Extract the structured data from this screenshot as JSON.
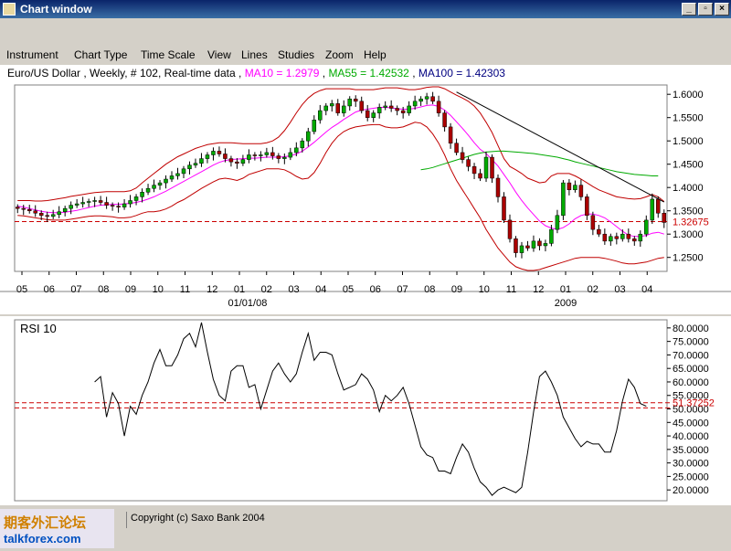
{
  "window": {
    "title": "Chart window",
    "btn_min": "_",
    "btn_max": "▫",
    "btn_close": "×"
  },
  "menu": [
    "Instrument",
    "Chart Type",
    "Time Scale",
    "View",
    "Lines",
    "Studies",
    "Zoom",
    "Help"
  ],
  "info": {
    "prefix": "Euro/US Dollar , Weekly, # 102, Real-time data",
    "ma10": "MA10 = 1.2979",
    "ma55": "MA55 = 1.42532",
    "ma100": "MA100 = 1.42303"
  },
  "colors": {
    "ma10": "#ff00ff",
    "ma55": "#00aa00",
    "ma100": "#000080",
    "candle_up": "#00aa00",
    "candle_down": "#aa0000",
    "bands": "#c00000",
    "level": "#cc0000"
  },
  "footer": {
    "copyright": "Copyright (c) Saxo Bank 2004",
    "logo_text": "期客外汇论坛",
    "logo_site": "talkforex.com"
  },
  "chart_data": [
    {
      "type": "candlestick",
      "title": "Euro/US Dollar , Weekly, # 102, Real-time data",
      "x_ticks": [
        "05",
        "06",
        "07",
        "08",
        "09",
        "10",
        "11",
        "12",
        "01",
        "02",
        "03",
        "04",
        "05",
        "06",
        "07",
        "08",
        "09",
        "10",
        "11",
        "12",
        "01",
        "02",
        "03",
        "04"
      ],
      "x_year_labels": [
        "01/01/08",
        "2009"
      ],
      "y_ticks": [
        "1.6000",
        "1.5500",
        "1.5000",
        "1.4500",
        "1.4000",
        "1.3500",
        "1.3000",
        "1.2500"
      ],
      "ylim": [
        1.22,
        1.62
      ],
      "current_price_label": "1.32675",
      "current_price": 1.32675,
      "close_series": [
        1.355,
        1.353,
        1.35,
        1.345,
        1.34,
        1.338,
        1.342,
        1.348,
        1.355,
        1.362,
        1.365,
        1.368,
        1.37,
        1.372,
        1.368,
        1.362,
        1.36,
        1.358,
        1.365,
        1.372,
        1.38,
        1.39,
        1.398,
        1.405,
        1.41,
        1.418,
        1.425,
        1.43,
        1.44,
        1.448,
        1.452,
        1.462,
        1.47,
        1.478,
        1.472,
        1.462,
        1.455,
        1.452,
        1.46,
        1.47,
        1.468,
        1.47,
        1.475,
        1.468,
        1.462,
        1.465,
        1.475,
        1.485,
        1.5,
        1.52,
        1.545,
        1.565,
        1.575,
        1.58,
        1.56,
        1.575,
        1.59,
        1.585,
        1.565,
        1.55,
        1.56,
        1.572,
        1.575,
        1.57,
        1.565,
        1.56,
        1.575,
        1.585,
        1.59,
        1.595,
        1.585,
        1.56,
        1.53,
        1.495,
        1.475,
        1.46,
        1.445,
        1.43,
        1.42,
        1.465,
        1.42,
        1.38,
        1.33,
        1.29,
        1.26,
        1.275,
        1.27,
        1.285,
        1.275,
        1.28,
        1.31,
        1.34,
        1.41,
        1.395,
        1.405,
        1.38,
        1.34,
        1.31,
        1.3,
        1.285,
        1.295,
        1.29,
        1.3,
        1.29,
        1.285,
        1.3,
        1.33,
        1.375,
        1.345,
        1.325
      ],
      "ma10_series": [
        1.36,
        1.358,
        1.355,
        1.352,
        1.349,
        1.347,
        1.346,
        1.346,
        1.347,
        1.349,
        1.351,
        1.354,
        1.357,
        1.36,
        1.362,
        1.363,
        1.364,
        1.364,
        1.365,
        1.366,
        1.368,
        1.371,
        1.375,
        1.38,
        1.386,
        1.392,
        1.399,
        1.406,
        1.413,
        1.42,
        1.427,
        1.434,
        1.441,
        1.448,
        1.454,
        1.458,
        1.46,
        1.461,
        1.462,
        1.463,
        1.463,
        1.464,
        1.465,
        1.465,
        1.465,
        1.466,
        1.468,
        1.472,
        1.478,
        1.487,
        1.497,
        1.508,
        1.519,
        1.529,
        1.537,
        1.546,
        1.554,
        1.562,
        1.566,
        1.568,
        1.57,
        1.572,
        1.572,
        1.571,
        1.569,
        1.568,
        1.568,
        1.57,
        1.573,
        1.576,
        1.577,
        1.574,
        1.566,
        1.555,
        1.541,
        1.527,
        1.512,
        1.496,
        1.482,
        1.473,
        1.46,
        1.446,
        1.428,
        1.41,
        1.39,
        1.372,
        1.356,
        1.342,
        1.328,
        1.318,
        1.313,
        1.31,
        1.314,
        1.322,
        1.333,
        1.34,
        1.343,
        1.343,
        1.34,
        1.335,
        1.326,
        1.316,
        1.306,
        1.298,
        1.295,
        1.295,
        1.297,
        1.302,
        1.304,
        1.3
      ],
      "ma55_series": [
        1.438,
        1.44,
        1.443,
        1.447,
        1.451,
        1.455,
        1.459,
        1.463,
        1.467,
        1.471,
        1.474,
        1.476,
        1.477,
        1.478,
        1.478,
        1.477,
        1.476,
        1.475,
        1.474,
        1.473,
        1.471,
        1.469,
        1.467,
        1.465,
        1.462,
        1.459,
        1.455,
        1.452,
        1.449,
        1.446,
        1.443,
        1.44,
        1.437,
        1.434,
        1.432,
        1.43,
        1.428,
        1.427,
        1.426,
        1.425,
        1.425
      ],
      "ma55_start_index": 68,
      "bb_upper_series": [
        1.372,
        1.372,
        1.372,
        1.371,
        1.371,
        1.372,
        1.374,
        1.376,
        1.378,
        1.381,
        1.383,
        1.385,
        1.387,
        1.389,
        1.39,
        1.391,
        1.391,
        1.391,
        1.391,
        1.393,
        1.399,
        1.41,
        1.42,
        1.43,
        1.44,
        1.45,
        1.458,
        1.466,
        1.472,
        1.478,
        1.484,
        1.488,
        1.492,
        1.494,
        1.496,
        1.496,
        1.496,
        1.495,
        1.494,
        1.494,
        1.494,
        1.494,
        1.496,
        1.5,
        1.508,
        1.522,
        1.54,
        1.56,
        1.578,
        1.592,
        1.602,
        1.608,
        1.612,
        1.612,
        1.612,
        1.612,
        1.612,
        1.61,
        1.61,
        1.61,
        1.61,
        1.612,
        1.614,
        1.614,
        1.614,
        1.612,
        1.61,
        1.61,
        1.612,
        1.615,
        1.616,
        1.616,
        1.612,
        1.605,
        1.598,
        1.592,
        1.585,
        1.575,
        1.56,
        1.54,
        1.518,
        1.49,
        1.462,
        1.445,
        1.438,
        1.43,
        1.42,
        1.415,
        1.41,
        1.412,
        1.425,
        1.43,
        1.43,
        1.43,
        1.425,
        1.418,
        1.41,
        1.402,
        1.395,
        1.39,
        1.385,
        1.38,
        1.378,
        1.376,
        1.375,
        1.376,
        1.38,
        1.385,
        1.38,
        1.37
      ],
      "bb_lower_series": [
        1.34,
        1.339,
        1.337,
        1.335,
        1.333,
        1.331,
        1.33,
        1.33,
        1.33,
        1.332,
        1.334,
        1.336,
        1.338,
        1.339,
        1.339,
        1.338,
        1.337,
        1.335,
        1.335,
        1.336,
        1.34,
        1.345,
        1.348,
        1.348,
        1.35,
        1.354,
        1.36,
        1.368,
        1.374,
        1.382,
        1.39,
        1.398,
        1.405,
        1.412,
        1.418,
        1.42,
        1.418,
        1.415,
        1.42,
        1.428,
        1.432,
        1.436,
        1.44,
        1.44,
        1.44,
        1.438,
        1.432,
        1.424,
        1.418,
        1.42,
        1.432,
        1.452,
        1.475,
        1.495,
        1.51,
        1.52,
        1.526,
        1.53,
        1.532,
        1.534,
        1.535,
        1.535,
        1.53,
        1.528,
        1.528,
        1.53,
        1.535,
        1.54,
        1.538,
        1.53,
        1.515,
        1.495,
        1.47,
        1.44,
        1.415,
        1.395,
        1.375,
        1.355,
        1.335,
        1.31,
        1.29,
        1.27,
        1.255,
        1.24,
        1.23,
        1.225,
        1.222,
        1.222,
        1.224,
        1.228,
        1.232,
        1.236,
        1.24,
        1.244,
        1.248,
        1.25,
        1.25,
        1.25,
        1.25,
        1.248,
        1.245,
        1.242,
        1.238,
        1.236,
        1.236,
        1.238,
        1.24,
        1.244,
        1.248,
        1.25
      ],
      "trendline": {
        "start_index": 74,
        "start_value": 1.605,
        "end_index": 109,
        "end_value": 1.369
      }
    },
    {
      "type": "line",
      "title": "RSI 10",
      "y_ticks": [
        "80.0000",
        "75.0000",
        "70.0000",
        "65.0000",
        "60.0000",
        "55.0000",
        "50.0000",
        "45.0000",
        "40.0000",
        "35.0000",
        "30.0000",
        "25.0000",
        "20.0000"
      ],
      "ylim": [
        16,
        83
      ],
      "current_label": "51.37252",
      "level_lines": [
        52.3,
        50.4
      ],
      "start_index": 13,
      "values": [
        60,
        62,
        47,
        56,
        52,
        40,
        51,
        48,
        55,
        60,
        67,
        72,
        66,
        66,
        70,
        76,
        78,
        73,
        82,
        71,
        61,
        55,
        53,
        64,
        66,
        66,
        58,
        59,
        50,
        57,
        64,
        67,
        63,
        60,
        63,
        71,
        78,
        68,
        71,
        71,
        70,
        63,
        57,
        58,
        59,
        63,
        61,
        57,
        49,
        55,
        53,
        55,
        58,
        52,
        44,
        36,
        33,
        32,
        27,
        27,
        26,
        32,
        37,
        34,
        28,
        23,
        21,
        18,
        20,
        21,
        20,
        19,
        21,
        34,
        49,
        62,
        64,
        60,
        55,
        47,
        43,
        39,
        36,
        38,
        37,
        37,
        34,
        34,
        42,
        53,
        61,
        58,
        52,
        51
      ]
    }
  ]
}
